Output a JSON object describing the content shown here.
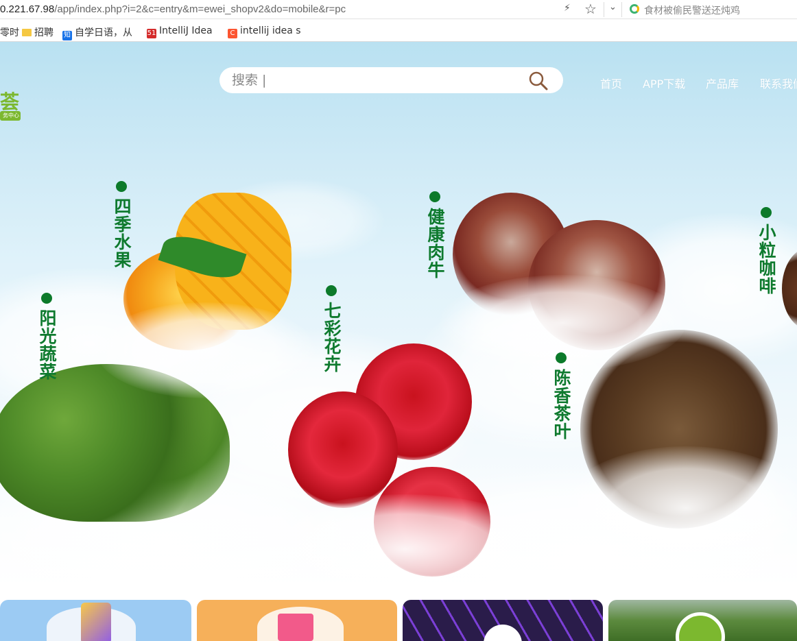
{
  "browser": {
    "url_host": "0.221.67.98",
    "url_path": "/app/index.php?i=2&c=entry&m=ewei_shopv2&do=mobile&r=pc",
    "search_suggestion": "食材被偷民警送还炖鸡",
    "bookmarks": [
      {
        "label": "零时",
        "icon": "none"
      },
      {
        "label": "招聘",
        "icon": "folder-icon"
      },
      {
        "label": "自学日语，从",
        "icon": "zhihu-icon"
      },
      {
        "label": "IntelliJ Idea",
        "icon": "51cto-icon"
      },
      {
        "label": "intellij idea s",
        "icon": "csdn-icon"
      }
    ]
  },
  "site": {
    "logo_text": "荟",
    "logo_sub": "务中心",
    "search_placeholder": "搜索 |",
    "nav": [
      "首页",
      "APP下载",
      "产品库",
      "联系我们"
    ]
  },
  "categories": [
    {
      "id": "sunny-veg",
      "label": "阳光蔬菜"
    },
    {
      "id": "four-season-fruit",
      "label": "四季水果"
    },
    {
      "id": "colorful-flowers",
      "label": "七彩花卉"
    },
    {
      "id": "healthy-beef",
      "label": "健康肉牛"
    },
    {
      "id": "aged-tea",
      "label": "陈香茶叶"
    },
    {
      "id": "small-coffee",
      "label": "小粒咖啡"
    }
  ],
  "colors": {
    "brand_green": "#0c7a2a",
    "logo_green": "#7cb82f",
    "card_blue": "#9ccbf3",
    "card_orange": "#f6b05a",
    "card_purple": "#2a1c4a",
    "card_field": "#6b8f52"
  }
}
